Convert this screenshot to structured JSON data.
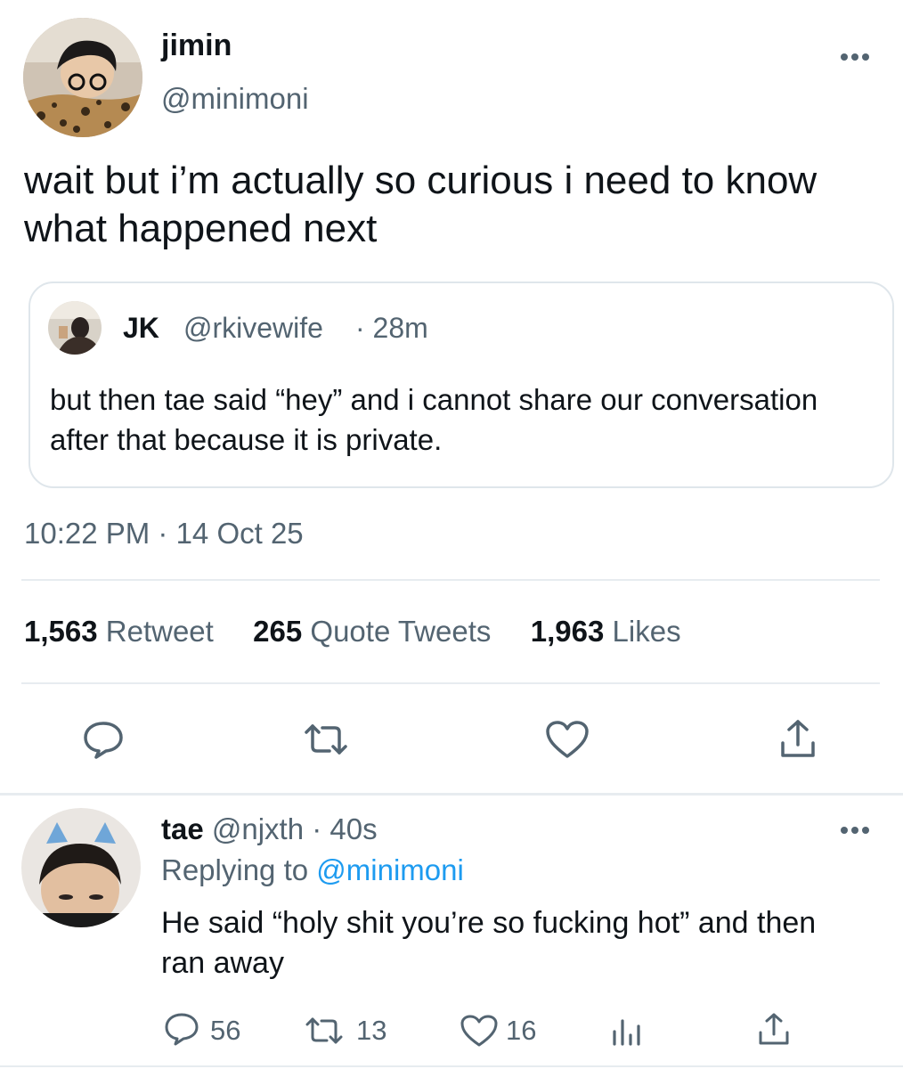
{
  "main_tweet": {
    "author_name": "jimin",
    "author_handle": "@minimoni",
    "more_icon": "more-horizontal-icon",
    "text": "wait but i’m actually so curious i need to know what happened next",
    "quoted": {
      "author_name": "JK",
      "author_handle": "@rkivewife",
      "time": "· 28m",
      "text": "but then tae said “hey” and i cannot share our conversation after that because it is private."
    },
    "timestamp": "10:22 PM · 14 Oct 25",
    "stats": {
      "retweets_count": "1,563",
      "retweets_label": "Retweet",
      "quotes_count": "265",
      "quotes_label": "Quote Tweets",
      "likes_count": "1,963",
      "likes_label": "Likes"
    },
    "actions": [
      "reply-icon",
      "retweet-icon",
      "like-icon",
      "share-icon"
    ]
  },
  "reply_tweet": {
    "author_name": "tae",
    "author_handle": "@njxth",
    "time": "· 40s",
    "replying_label": "Replying to",
    "replying_handle": "@minimoni",
    "text": "He said “holy shit you’re so fucking hot” and then ran away",
    "counts": {
      "replies": "56",
      "retweets": "13",
      "likes": "16"
    }
  },
  "colors": {
    "text": "#0f1419",
    "muted": "#536471",
    "accent": "#1d9bf0",
    "divider": "#e7ecf0"
  }
}
